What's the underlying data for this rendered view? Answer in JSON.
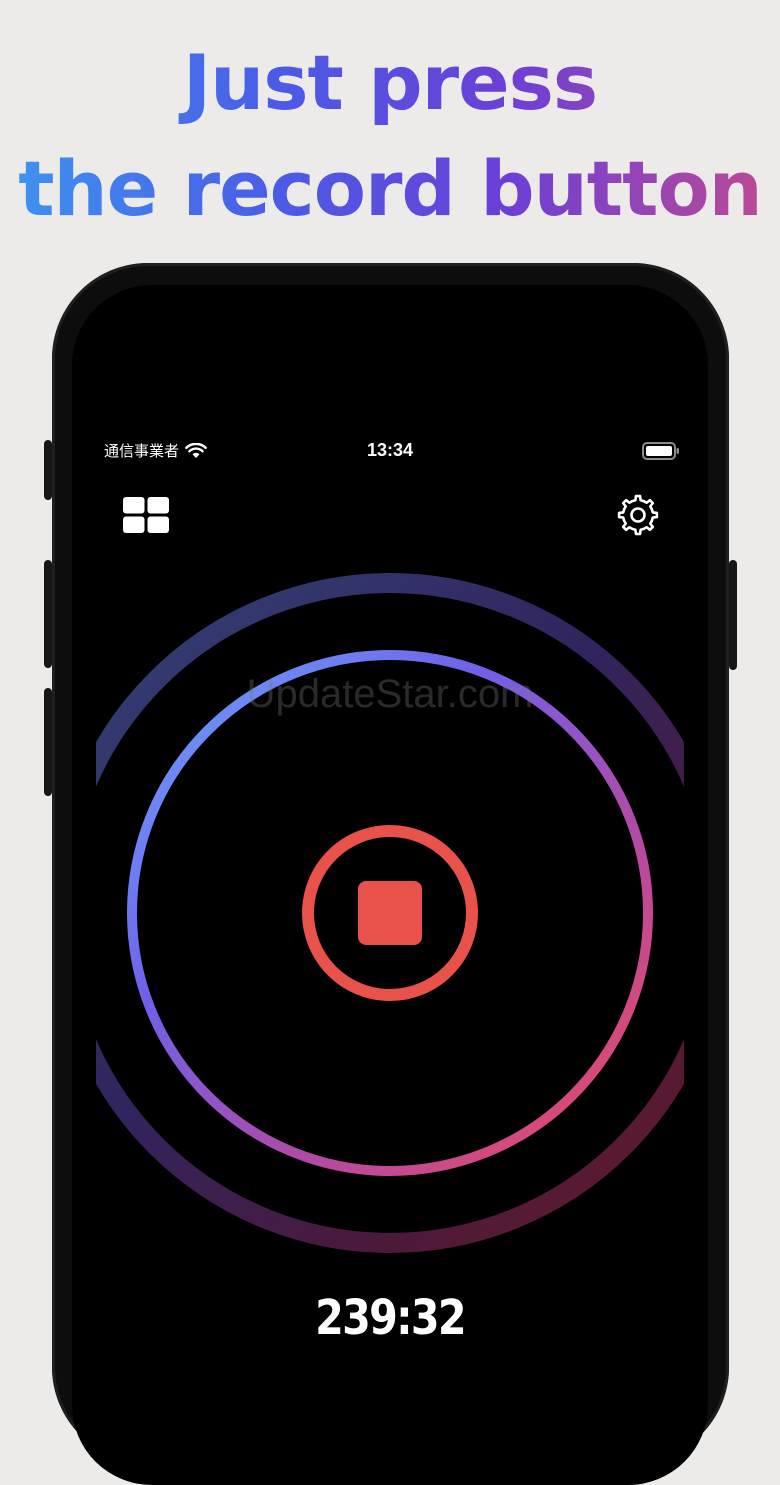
{
  "headline": {
    "line1": "Just press",
    "line2": "the record button"
  },
  "status_bar": {
    "carrier": "通信事業者",
    "time": "13:34",
    "wifi_icon": "wifi-icon",
    "battery_icon": "battery-icon"
  },
  "toolbar": {
    "grid_icon": "grid-icon",
    "settings_icon": "gear-icon"
  },
  "recorder": {
    "timer": "239:32",
    "stop_icon": "stop-icon",
    "accent": "#e8524a"
  },
  "watermark": "UpdateStar.com"
}
